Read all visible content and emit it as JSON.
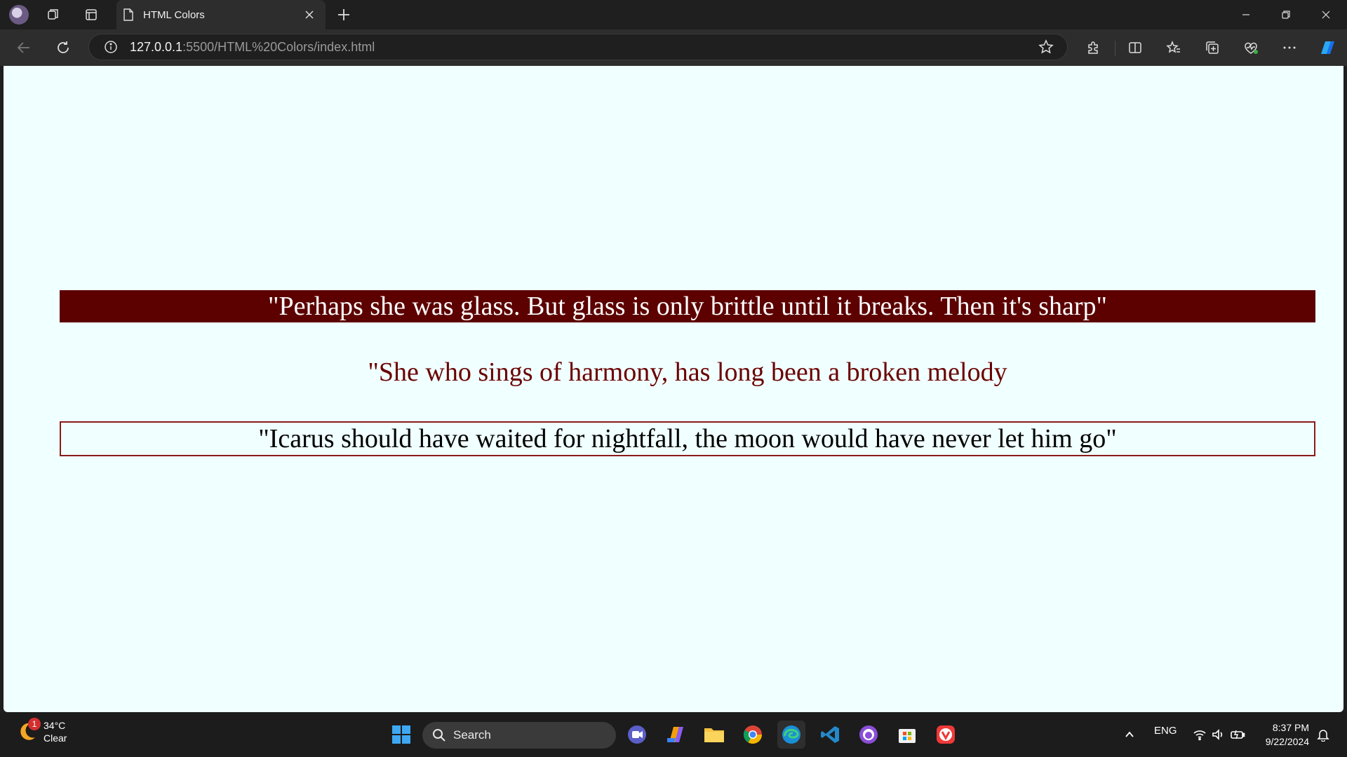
{
  "browser": {
    "tab_title": "HTML Colors",
    "url_host": "127.0.0.1",
    "url_rest": ":5500/HTML%20Colors/index.html"
  },
  "page": {
    "background": "#f0ffff",
    "quotes": [
      {
        "text": "\"Perhaps she was glass. But glass is only brittle until it breaks. Then it's sharp\"",
        "color": "#ffffff",
        "background": "#5c0000"
      },
      {
        "text": "\"She who sings of harmony, has long been a broken melody",
        "color": "#6b0000"
      },
      {
        "text": "\"Icarus should have waited for nightfall, the moon would have never let him go\"",
        "color": "#000000",
        "border_color": "#8b1a1a"
      }
    ]
  },
  "taskbar": {
    "weather": {
      "temp": "34°C",
      "condition": "Clear",
      "badge": "1"
    },
    "search_label": "Search",
    "language": "ENG",
    "time": "8:37 PM",
    "date": "9/22/2024"
  }
}
